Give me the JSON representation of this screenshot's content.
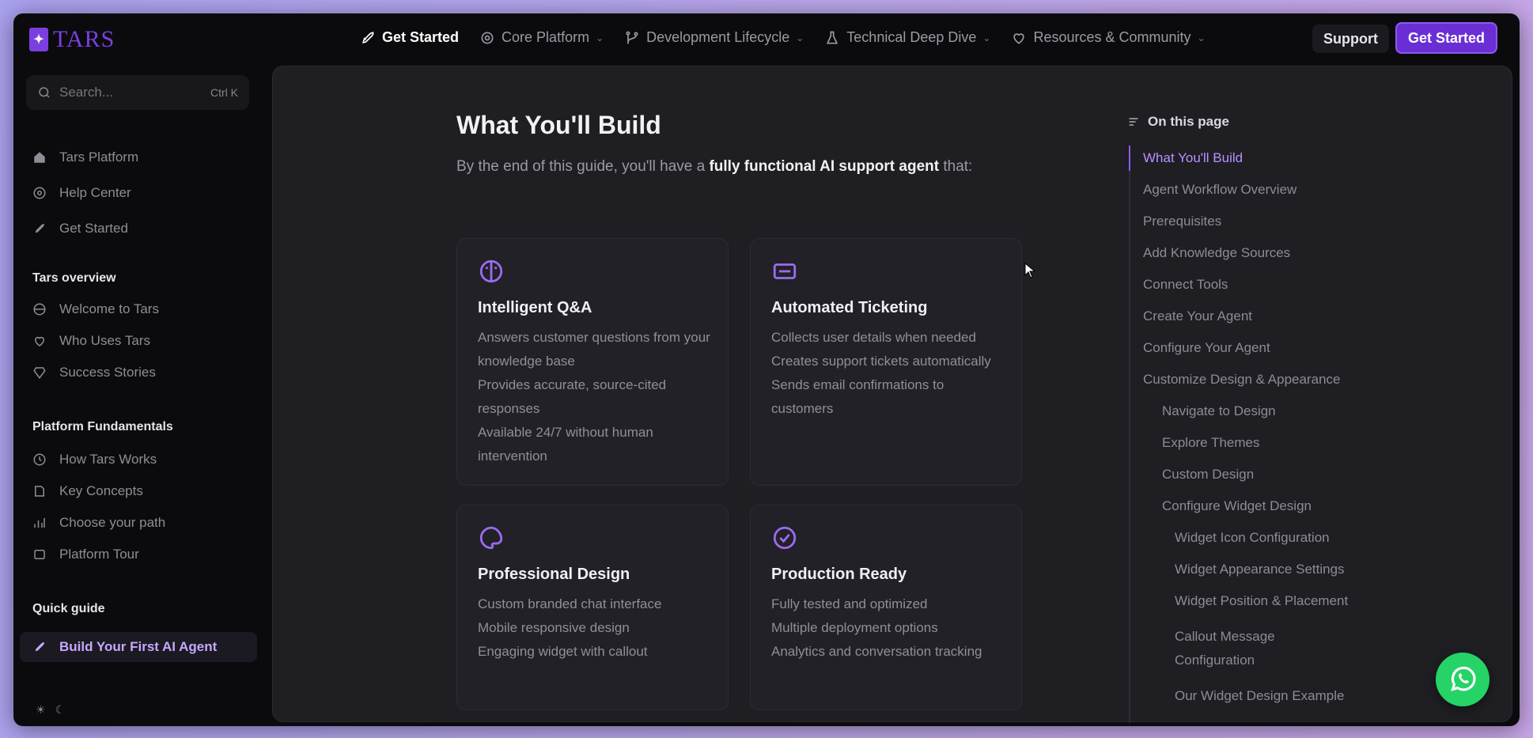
{
  "brand": {
    "logo_text": "TARS",
    "accent": "#7b3fe0"
  },
  "topnav": {
    "items": [
      {
        "label": "Get Started",
        "icon": "rocket-icon"
      },
      {
        "label": "Core Platform",
        "icon": "gear-icon"
      },
      {
        "label": "Development Lifecycle",
        "icon": "branch-icon"
      },
      {
        "label": "Technical Deep Dive",
        "icon": "flask-icon"
      },
      {
        "label": "Resources & Community",
        "icon": "heart-icon"
      }
    ],
    "support_label": "Support",
    "get_started_label": "Get Started"
  },
  "sidebar": {
    "search_placeholder": "Search...",
    "search_shortcut": "Ctrl K",
    "top_links": [
      "Tars Platform",
      "Help Center",
      "Get Started"
    ],
    "section1": {
      "title": "Tars overview",
      "items": [
        "Welcome to Tars",
        "Who Uses Tars",
        "Success Stories"
      ]
    },
    "section2": {
      "title": "Platform Fundamentals",
      "items": [
        "How Tars Works",
        "Key Concepts",
        "Choose your path",
        "Platform Tour"
      ]
    },
    "section3": {
      "title": "Quick guide",
      "items": [
        "Build Your First AI Agent"
      ]
    }
  },
  "main": {
    "title": "What You'll Build",
    "lead_before": "By the end of this guide, you'll have a ",
    "lead_strong": "fully functional AI support agent",
    "lead_after": " that:",
    "cards": [
      {
        "title": "Intelligent Q&A",
        "icon": "brain-icon",
        "items": [
          "Answers customer questions from your knowledge base",
          "Provides accurate, source-cited responses",
          "Available 24/7 without human intervention"
        ]
      },
      {
        "title": "Automated Ticketing",
        "icon": "ticket-icon",
        "items": [
          "Collects user details when needed",
          "Creates support tickets automatically",
          "Sends email confirmations to customers"
        ]
      },
      {
        "title": "Professional Design",
        "icon": "palette-icon",
        "items": [
          "Custom branded chat interface",
          "Mobile responsive design",
          "Engaging widget with callout"
        ]
      },
      {
        "title": "Production Ready",
        "icon": "check-circle-icon",
        "items": [
          "Fully tested and optimized",
          "Multiple deployment options",
          "Analytics and conversation tracking"
        ]
      }
    ]
  },
  "toc": {
    "title": "On this page",
    "items": [
      "What You'll Build",
      "Agent Workflow Overview",
      "Prerequisites",
      "Add Knowledge Sources",
      "Connect Tools",
      "Create Your Agent",
      "Configure Your Agent",
      "Customize Design & Appearance",
      "Navigate to Design",
      "Explore Themes",
      "Custom Design",
      "Configure Widget Design",
      "Widget Icon Configuration",
      "Widget Appearance Settings",
      "Widget Position & Placement",
      "Callout Message Configuration",
      "Our Widget Design Example"
    ]
  }
}
